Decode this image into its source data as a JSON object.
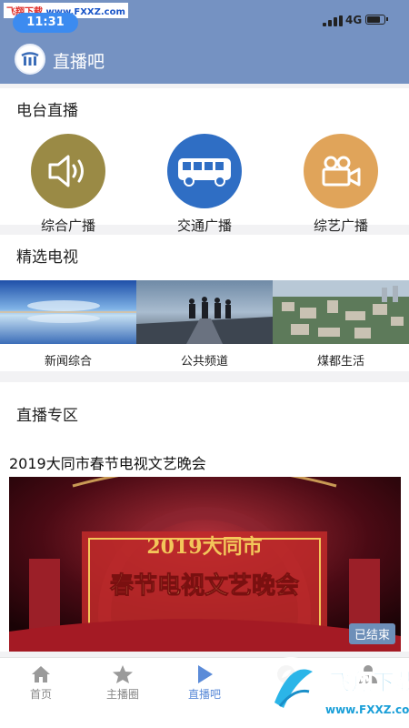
{
  "status_bar": {
    "watermark_site": "飞翔下载",
    "watermark_url": "www.FXXZ.com",
    "time": "11:31",
    "network": "4G"
  },
  "header": {
    "title": "直播吧"
  },
  "radio_section": {
    "title": "电台直播",
    "items": [
      {
        "label": "综合广播",
        "icon": "speaker-icon",
        "color": "#9a8a45"
      },
      {
        "label": "交通广播",
        "icon": "bus-icon",
        "color": "#2f6ec4"
      },
      {
        "label": "综艺广播",
        "icon": "video-camera-icon",
        "color": "#e0a45a"
      }
    ]
  },
  "tv_section": {
    "title": "精选电视",
    "items": [
      {
        "label": "新闻综合"
      },
      {
        "label": "公共频道"
      },
      {
        "label": "煤都生活"
      }
    ]
  },
  "live_section": {
    "title": "直播专区",
    "event_title": "2019大同市春节电视文艺晚会",
    "banner_text_top": "2019大同市",
    "banner_text_main": "春节电视文艺晚会",
    "status_badge": "已结束"
  },
  "tab_bar": {
    "items": [
      {
        "label": "首页",
        "icon": "home-icon"
      },
      {
        "label": "主播圈",
        "icon": "star-icon"
      },
      {
        "label": "直播吧",
        "icon": "play-icon",
        "active": true
      },
      {
        "label": "",
        "icon": "leaf-icon"
      },
      {
        "label": "",
        "icon": "user-icon"
      }
    ],
    "active_color": "#5b8bd8"
  },
  "bottom_watermark": {
    "brand": "飞翔下载",
    "url": "www.FXXZ.com"
  }
}
